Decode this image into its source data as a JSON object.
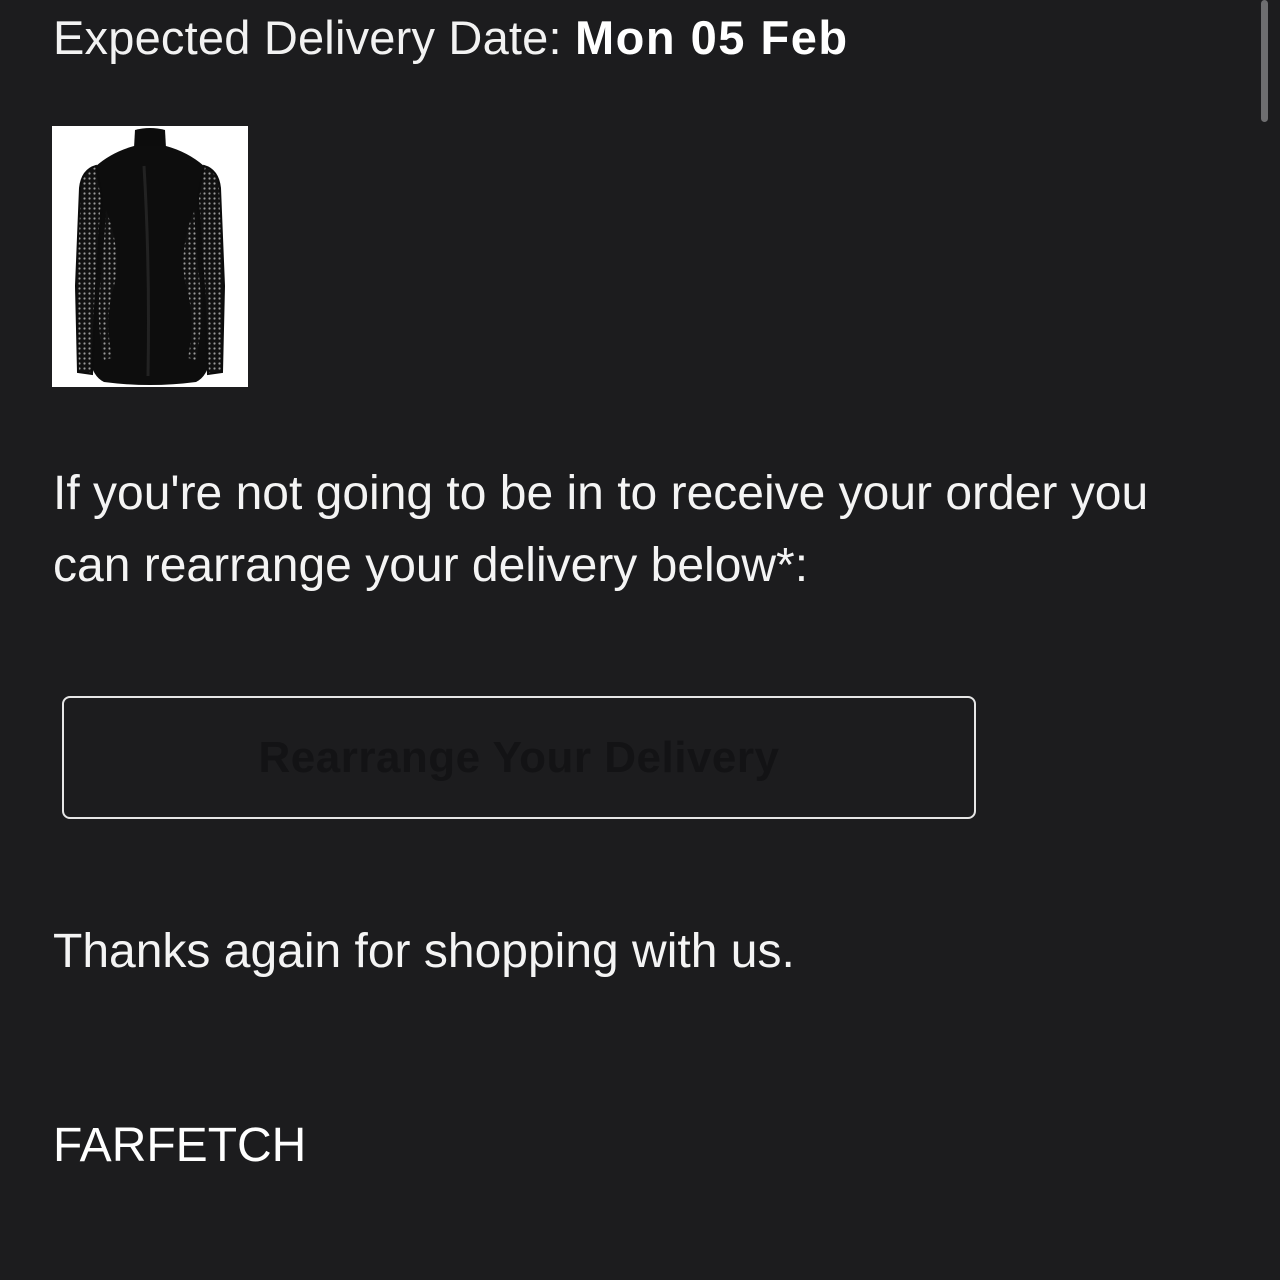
{
  "delivery": {
    "label": "Expected Delivery Date: ",
    "date": "Mon 05 Feb"
  },
  "product": {
    "image_alt": "black long-sleeve mesh cut-out mini dress"
  },
  "message": {
    "rearrange_text": "If you're not going to be in to receive your order you can rearrange your delivery below*:"
  },
  "actions": {
    "rearrange_label": "Rearrange Your Delivery"
  },
  "closing": {
    "thanks": "Thanks again for shopping with us.",
    "brand": "FARFETCH"
  },
  "colors": {
    "background": "#1c1c1e",
    "text": "#ffffff",
    "button_border": "#e6e6e6"
  }
}
